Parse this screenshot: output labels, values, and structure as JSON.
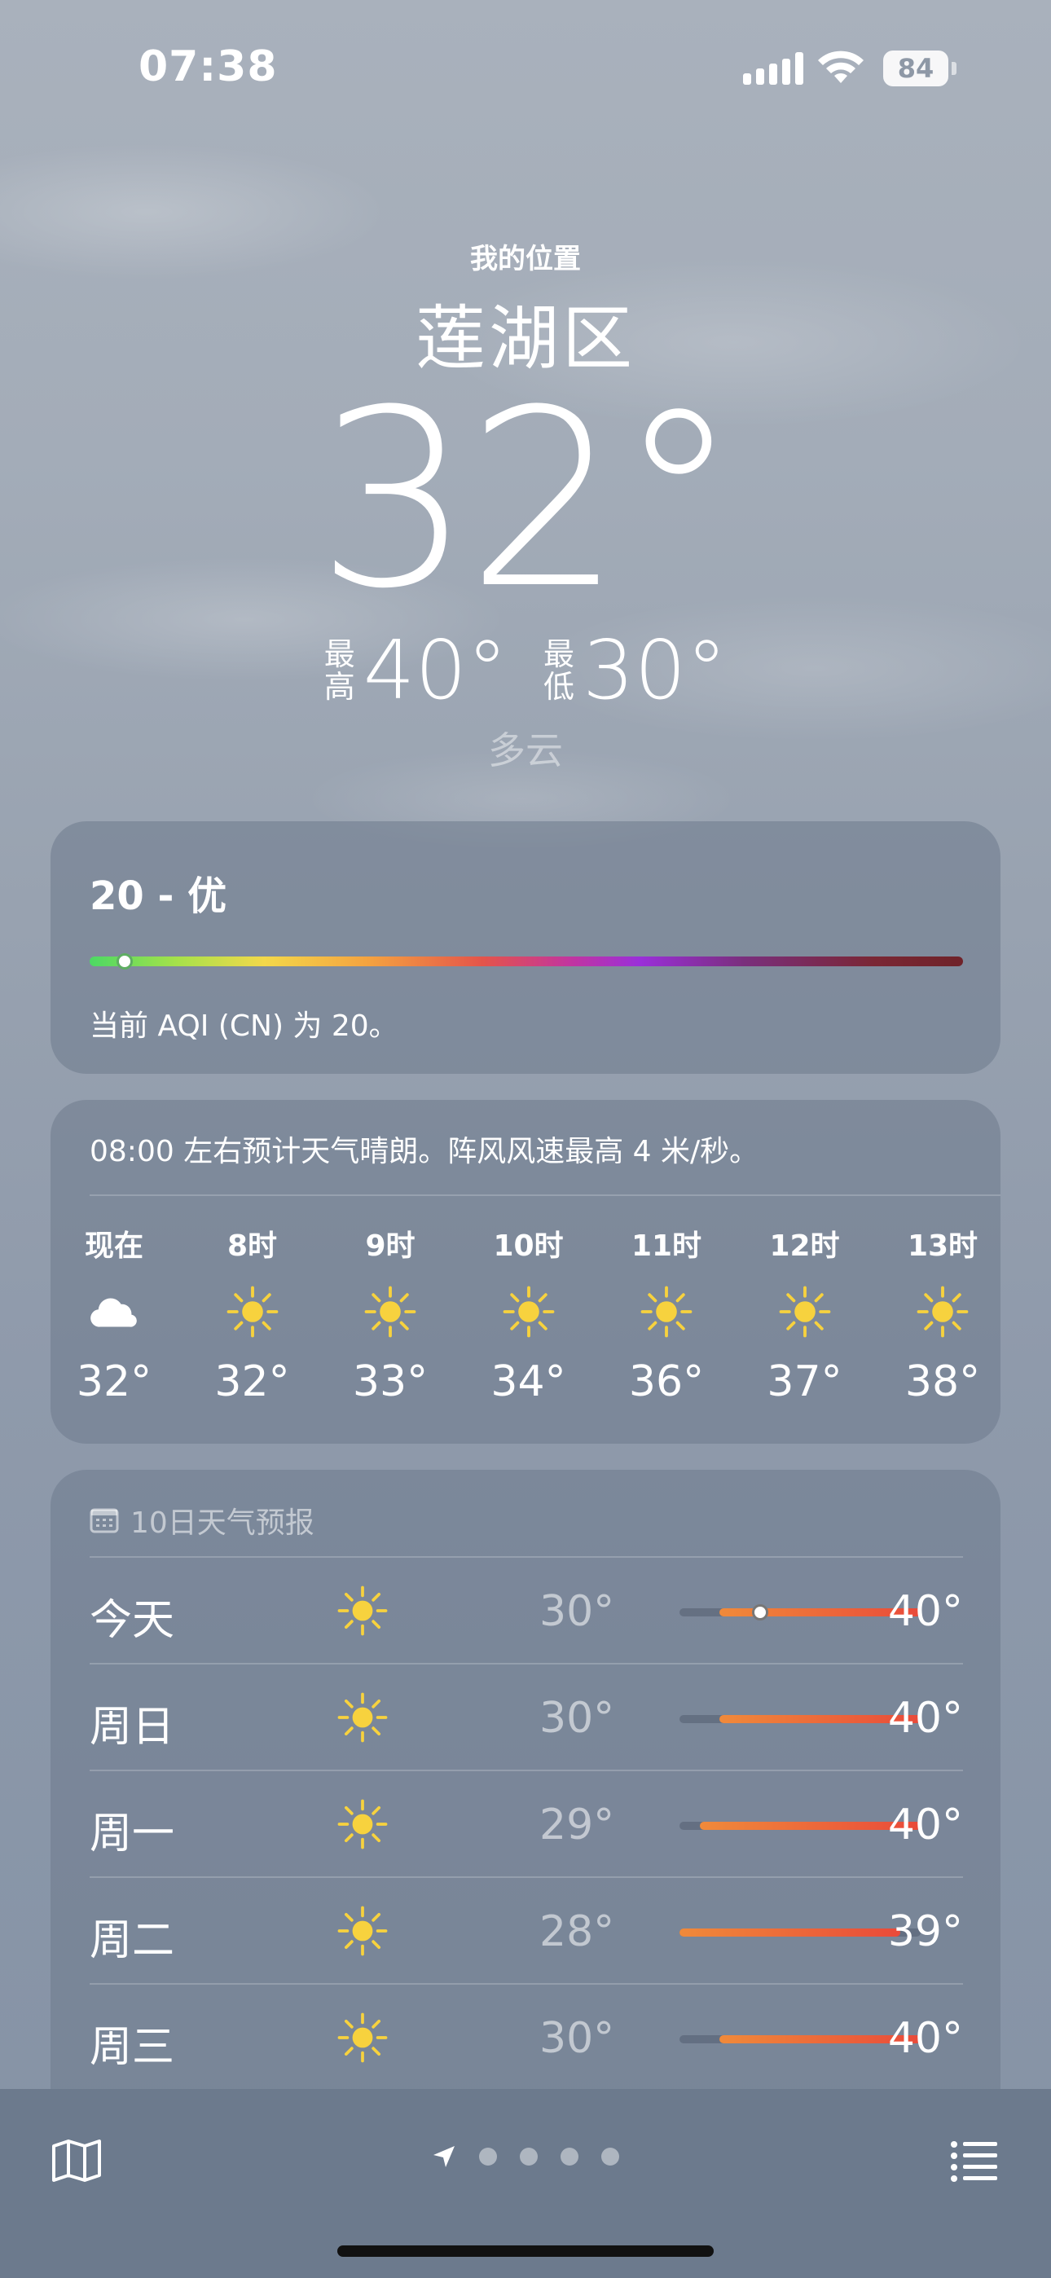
{
  "status_bar": {
    "time": "07:38",
    "battery": "84",
    "icons": [
      "cellular-icon",
      "wifi-icon",
      "battery-icon"
    ]
  },
  "header": {
    "location_label": "我的位置",
    "city": "莲湖区",
    "temperature": "32°",
    "high_label": [
      "最",
      "高"
    ],
    "high": "40°",
    "low_label": [
      "最",
      "低"
    ],
    "low": "30°",
    "condition": "多云"
  },
  "aqi": {
    "title": "20 - 优",
    "description": "当前 AQI (CN) 为 20。",
    "level_fraction": 0.04
  },
  "hourly": {
    "summary": "08:00 左右预计天气晴朗。阵风风速最高 4 米/秒。",
    "items": [
      {
        "hour": "现在",
        "icon": "cloud-icon",
        "temp": "32°"
      },
      {
        "hour": "8时",
        "icon": "sun-icon",
        "temp": "32°"
      },
      {
        "hour": "9时",
        "icon": "sun-icon",
        "temp": "33°"
      },
      {
        "hour": "10时",
        "icon": "sun-icon",
        "temp": "34°"
      },
      {
        "hour": "11时",
        "icon": "sun-icon",
        "temp": "36°"
      },
      {
        "hour": "12时",
        "icon": "sun-icon",
        "temp": "37°"
      },
      {
        "hour": "13时",
        "icon": "sun-icon",
        "temp": "38°"
      }
    ]
  },
  "daily": {
    "header": "10日天气预报",
    "range_min": 28,
    "range_max": 40,
    "days": [
      {
        "day": "今天",
        "icon": "sun-icon",
        "low": "30°",
        "high": "40°",
        "low_value": 30,
        "high_value": 40,
        "current_value": 32
      },
      {
        "day": "周日",
        "icon": "sun-icon",
        "low": "30°",
        "high": "40°",
        "low_value": 30,
        "high_value": 40
      },
      {
        "day": "周一",
        "icon": "sun-icon",
        "low": "29°",
        "high": "40°",
        "low_value": 29,
        "high_value": 40
      },
      {
        "day": "周二",
        "icon": "sun-icon",
        "low": "28°",
        "high": "39°",
        "low_value": 28,
        "high_value": 39
      },
      {
        "day": "周三",
        "icon": "sun-icon",
        "low": "30°",
        "high": "40°",
        "low_value": 30,
        "high_value": 40
      }
    ]
  },
  "bottom_bar": {
    "page_count": 4,
    "icons": [
      "map-icon",
      "location-arrow-icon",
      "list-icon"
    ]
  }
}
